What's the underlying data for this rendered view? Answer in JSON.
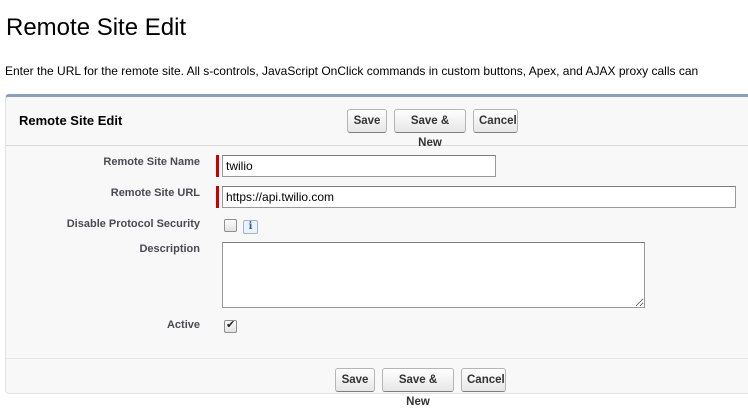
{
  "page": {
    "title": "Remote Site Edit",
    "intro": "Enter the URL for the remote site. All s-controls, JavaScript OnClick commands in custom buttons, Apex, and AJAX proxy calls can"
  },
  "panel": {
    "title": "Remote Site Edit",
    "buttons": {
      "save": "Save",
      "save_new": "Save & New",
      "cancel": "Cancel"
    }
  },
  "form": {
    "name_label": "Remote Site Name",
    "name_value": "twilio",
    "url_label": "Remote Site URL",
    "url_value": "https://api.twilio.com",
    "disable_security_label": "Disable Protocol Security",
    "disable_security_checked": false,
    "info_icon_glyph": "i",
    "description_label": "Description",
    "description_value": "",
    "active_label": "Active",
    "active_checked": true,
    "check_glyph": "✔"
  },
  "colors": {
    "required": "#cc0000",
    "panel_border": "#8a9ebe",
    "label_text": "#4a4a56"
  }
}
